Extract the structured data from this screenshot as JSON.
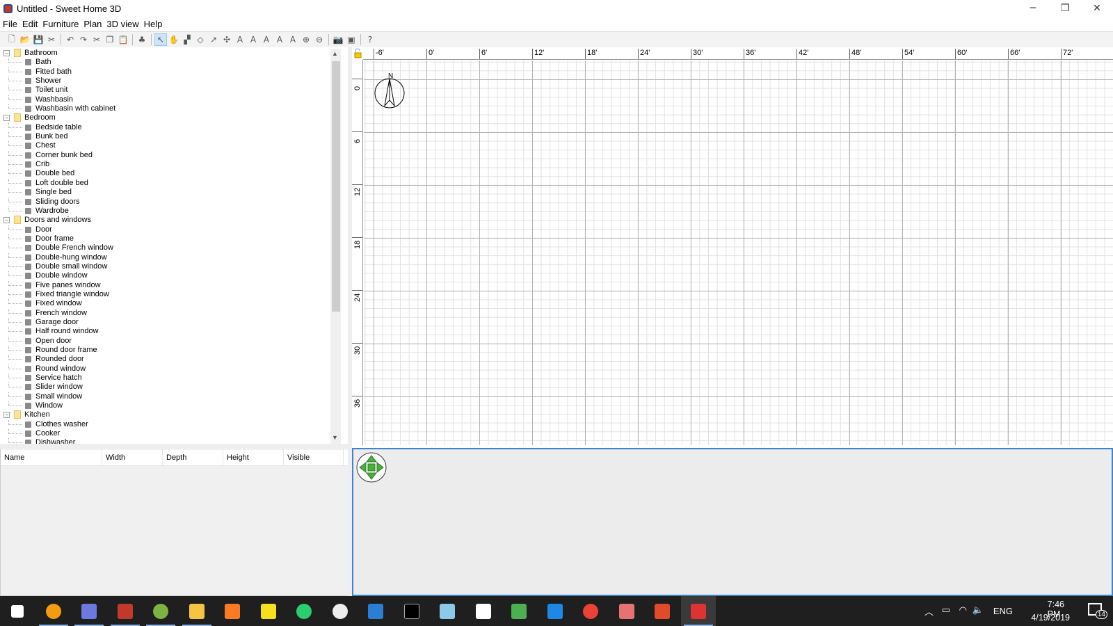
{
  "window": {
    "title": "Untitled - Sweet Home 3D",
    "minimize": "─",
    "restore": "❐",
    "close": "✕"
  },
  "menu": [
    "File",
    "Edit",
    "Furniture",
    "Plan",
    "3D view",
    "Help"
  ],
  "toolbar": [
    {
      "icon": "new-home-icon",
      "g": "🗋"
    },
    {
      "icon": "open-icon",
      "g": "📂"
    },
    {
      "icon": "save-icon",
      "g": "💾"
    },
    {
      "icon": "cut-preferences-icon",
      "g": "✂"
    },
    "sep",
    {
      "icon": "undo-icon",
      "g": "↶"
    },
    {
      "icon": "redo-icon",
      "g": "↷"
    },
    {
      "icon": "cut-icon",
      "g": "✂"
    },
    {
      "icon": "copy-icon",
      "g": "❐"
    },
    {
      "icon": "paste-icon",
      "g": "📋"
    },
    "sep",
    {
      "icon": "add-furniture-icon",
      "g": "♣"
    },
    "sep",
    {
      "icon": "select-icon",
      "g": "↖",
      "active": true
    },
    {
      "icon": "pan-icon",
      "g": "✋"
    },
    {
      "icon": "create-walls-icon",
      "g": "▞"
    },
    {
      "icon": "create-rooms-icon",
      "g": "◇"
    },
    {
      "icon": "create-polylines-icon",
      "g": "↗"
    },
    {
      "icon": "create-dimensions-icon",
      "g": "✣"
    },
    {
      "icon": "add-text-icon",
      "g": "A"
    },
    {
      "icon": "increase-text-size-icon",
      "g": "A"
    },
    {
      "icon": "decrease-text-size-icon",
      "g": "A"
    },
    {
      "icon": "bold-text-icon",
      "g": "A"
    },
    {
      "icon": "italic-text-icon",
      "g": "A"
    },
    {
      "icon": "zoom-in-icon",
      "g": "⊕"
    },
    {
      "icon": "zoom-out-icon",
      "g": "⊖"
    },
    "sep",
    {
      "icon": "create-photo-icon",
      "g": "📷"
    },
    {
      "icon": "create-video-icon",
      "g": "▣"
    },
    "sep",
    {
      "icon": "help-icon",
      "g": "?"
    }
  ],
  "catalog": [
    {
      "name": "Bathroom",
      "items": [
        "Bath",
        "Fitted bath",
        "Shower",
        "Toilet unit",
        "Washbasin",
        "Washbasin with cabinet"
      ]
    },
    {
      "name": "Bedroom",
      "items": [
        "Bedside table",
        "Bunk bed",
        "Chest",
        "Corner bunk bed",
        "Crib",
        "Double bed",
        "Loft double bed",
        "Single bed",
        "Sliding doors",
        "Wardrobe"
      ]
    },
    {
      "name": "Doors and windows",
      "items": [
        "Door",
        "Door frame",
        "Double French window",
        "Double-hung window",
        "Double small window",
        "Double window",
        "Five panes window",
        "Fixed triangle window",
        "Fixed window",
        "French window",
        "Garage door",
        "Half round window",
        "Open door",
        "Round door frame",
        "Rounded door",
        "Round window",
        "Service hatch",
        "Slider window",
        "Small window",
        "Window"
      ]
    },
    {
      "name": "Kitchen",
      "items": [
        "Clothes washer",
        "Cooker",
        "Dishwasher"
      ]
    }
  ],
  "furniture_table": {
    "columns": [
      "Name",
      "Width",
      "Depth",
      "Height",
      "Visible"
    ]
  },
  "plan": {
    "x_ticks": [
      "-6'",
      "0'",
      "6'",
      "12'",
      "18'",
      "24'",
      "30'",
      "36'",
      "42'",
      "48'",
      "54'",
      "60'",
      "66'",
      "72'"
    ],
    "y_ticks": [
      "0",
      "6",
      "12",
      "18",
      "24",
      "30",
      "36"
    ],
    "compass_label": "N"
  },
  "taskbar": {
    "apps": [
      "start",
      "vlc",
      "browser-app",
      "photo-editor",
      "android-studio",
      "file-explorer",
      "xampp",
      "sticky-notes",
      "spotify-like",
      "app-shield",
      "vscode",
      "terminal",
      "notepad",
      "calculator",
      "spreadsheet",
      "office",
      "chrome",
      "paint",
      "git",
      "sweet-home-3d"
    ],
    "time": "7:46 PM",
    "date": "4/19/2019",
    "language": "ENG",
    "notifications": "14"
  },
  "colors": {
    "accent": "#3c84d0",
    "taskbar": "#1f1f1f",
    "folder": "#fbe39a"
  }
}
